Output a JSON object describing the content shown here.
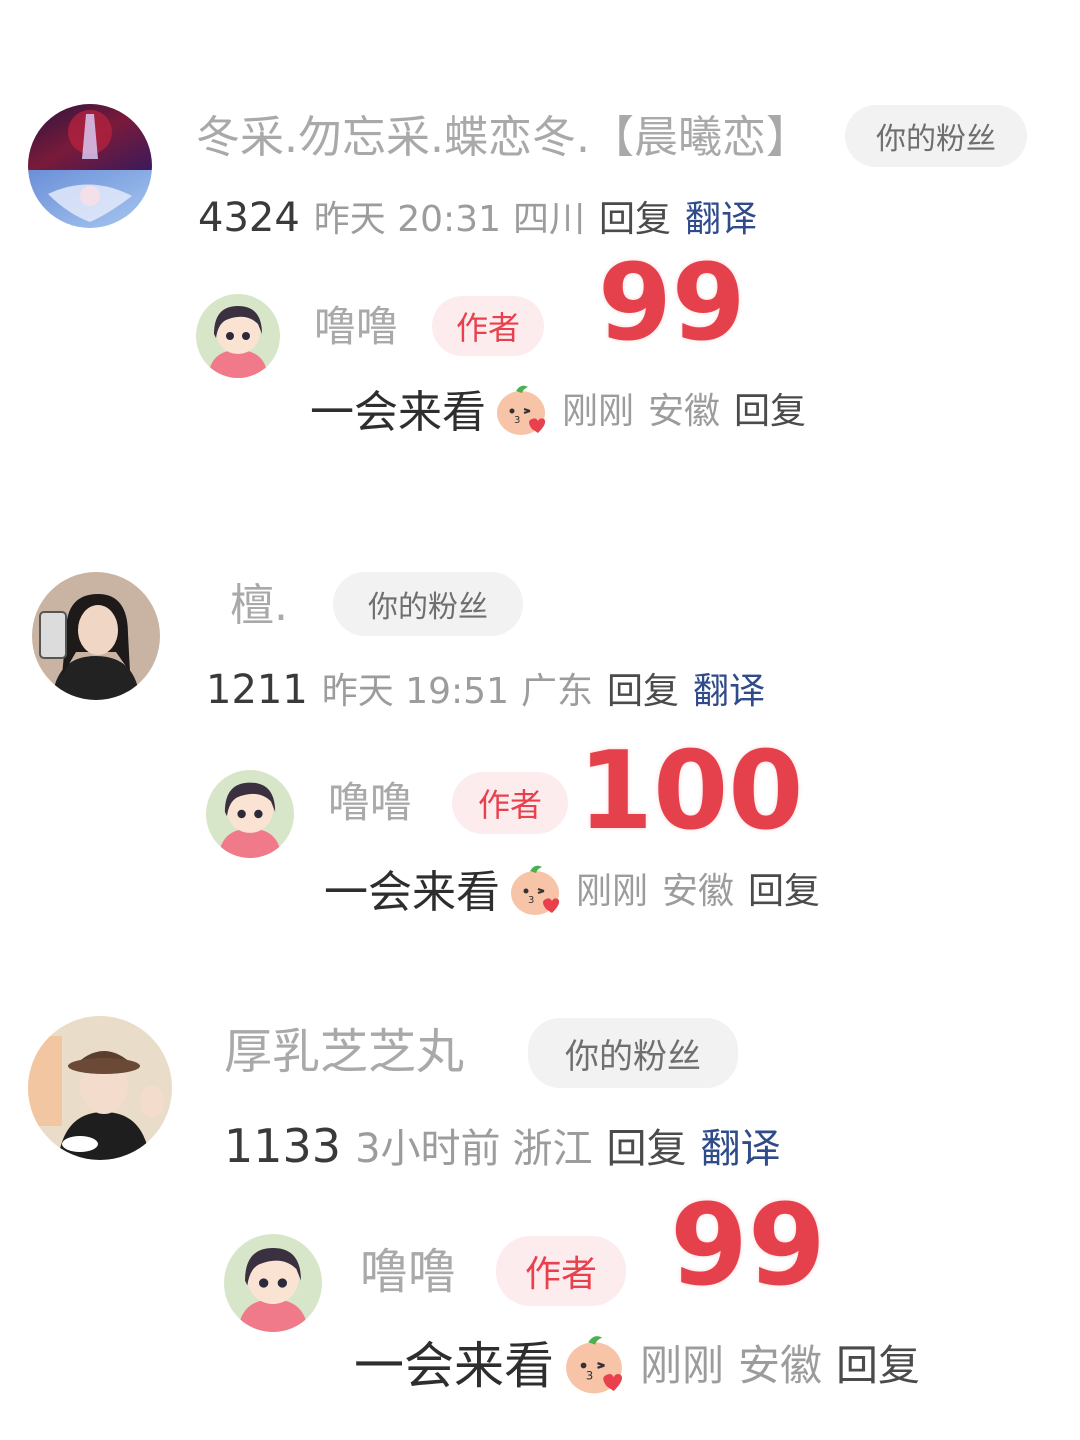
{
  "comments": [
    {
      "username": "冬采.勿忘采.蝶恋冬.【晨曦恋】",
      "badge": "你的粉丝",
      "likes": "4324",
      "time": "昨天 20:31",
      "location": "四川",
      "reply_label": "回复",
      "translate_label": "翻译",
      "avatar_icon": "fantasy-art-avatar-icon",
      "reply": {
        "username": "噜噜",
        "badge": "作者",
        "overlay_number": "99",
        "text": "一会来看",
        "emoji": "kissing-peach-emoji",
        "time": "刚刚",
        "location": "安徽",
        "reply_label": "回复"
      }
    },
    {
      "username": "檀.",
      "badge": "你的粉丝",
      "likes": "1211",
      "time": "昨天 19:51",
      "location": "广东",
      "reply_label": "回复",
      "translate_label": "翻译",
      "avatar_icon": "girl-photo-avatar-icon",
      "reply": {
        "username": "噜噜",
        "badge": "作者",
        "overlay_number": "100",
        "text": "一会来看",
        "emoji": "kissing-peach-emoji",
        "time": "刚刚",
        "location": "安徽",
        "reply_label": "回复"
      }
    },
    {
      "username": "厚乳芝芝丸",
      "badge": "你的粉丝",
      "likes": "1133",
      "time": "3小时前",
      "location": "浙江",
      "reply_label": "回复",
      "translate_label": "翻译",
      "avatar_icon": "woman-with-hat-avatar-icon",
      "reply": {
        "username": "噜噜",
        "badge": "作者",
        "overlay_number": "99",
        "text": "一会来看",
        "emoji": "kissing-peach-emoji",
        "time": "刚刚",
        "location": "安徽",
        "reply_label": "回复"
      }
    }
  ],
  "colors": {
    "author_badge_text": "#e8414d",
    "author_badge_bg": "#fdecee",
    "overlay_number": "#e5414c",
    "translate_link": "#2f4b8a",
    "fan_badge_bg": "#f2f2f3"
  }
}
